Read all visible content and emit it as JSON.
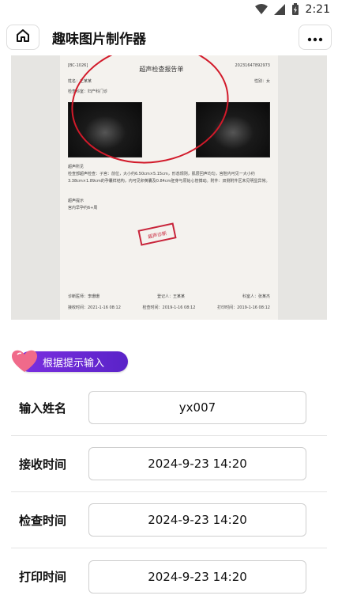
{
  "status": {
    "time": "2:21"
  },
  "header": {
    "title": "趣味图片制作器"
  },
  "preview": {
    "doc_title": "超声检查报告单",
    "doc_id": "[BC-1026]",
    "doc_no": "20231647892973",
    "name_line": "姓名：王某某",
    "sex_line": "性别：女",
    "dept_line": "检查科室：妇产科门诊",
    "section": "超声所见",
    "findings": "检查部超声检查：子宫：前位，大小约6.50cm×5.15cm，形态规则，肌层回声均匀，宫腔内可见一大小约3.38cm×1.89cm的孕囊样结构，内可见卵黄囊及0.84cm胚芽与原始心管搏动。附件：双侧附件区未见明显异常。",
    "prompt_title": "超声提示",
    "prompt_text": "宫内早孕约6+周",
    "stamp": "超声诊断",
    "doctor_line": "诊断医师：李珊珊",
    "verify_line": "登记人：王某某",
    "record_line": "科室人：张某杰",
    "receive_line": "接收时间：2021-1-16 08:12",
    "check_line": "检查时间：2019-1-16 08:12",
    "print_line": "打印时间：2019-1-16 08:12"
  },
  "hint": {
    "label": "根据提示输入"
  },
  "form": {
    "rows": [
      {
        "label": "输入姓名",
        "value": "yx007"
      },
      {
        "label": "接收时间",
        "value": "2024-9-23 14:20"
      },
      {
        "label": "检查时间",
        "value": "2024-9-23 14:20"
      },
      {
        "label": "打印时间",
        "value": "2024-9-23 14:20"
      }
    ]
  },
  "colors": {
    "accent": "#6a28d8",
    "stamp_red": "#c8243a"
  }
}
